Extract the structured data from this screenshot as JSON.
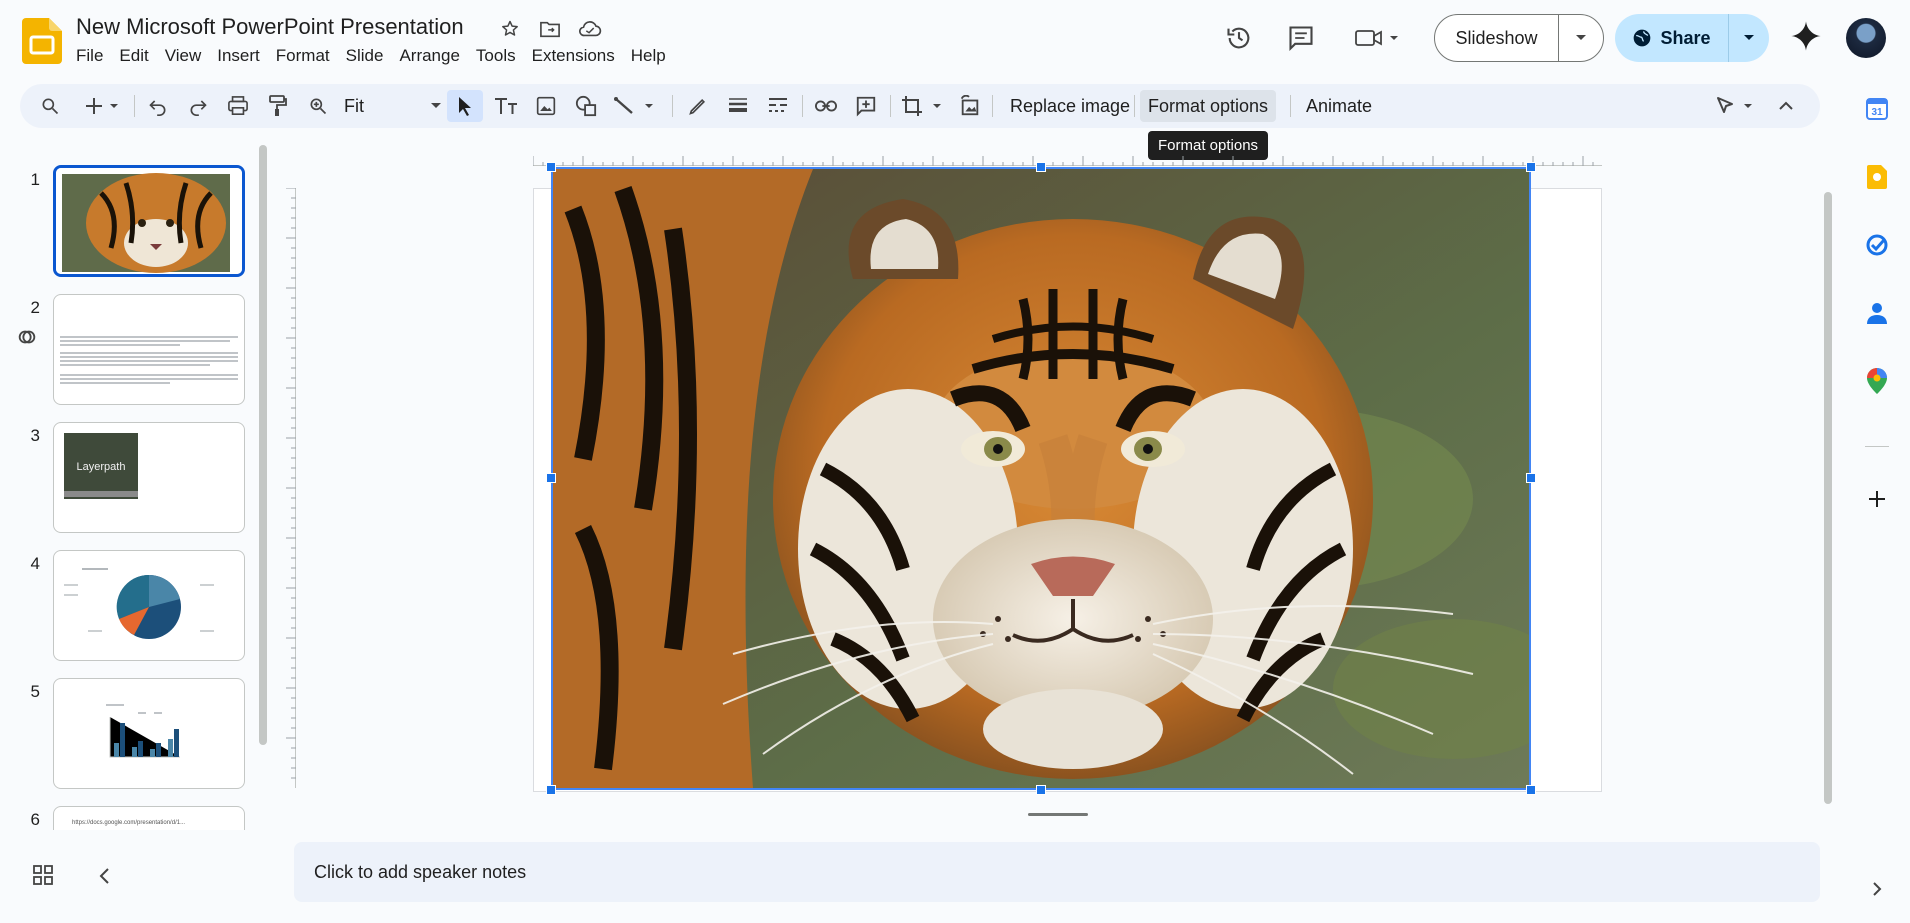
{
  "app": {
    "title": "New Microsoft PowerPoint Presentation"
  },
  "menu": [
    "File",
    "Edit",
    "View",
    "Insert",
    "Format",
    "Slide",
    "Arrange",
    "Tools",
    "Extensions",
    "Help"
  ],
  "header": {
    "slideshow_label": "Slideshow",
    "share_label": "Share"
  },
  "toolbar": {
    "zoom_value": "Fit",
    "replace_image_label": "Replace image",
    "format_options_label": "Format options",
    "animate_label": "Animate",
    "tooltip": "Format options"
  },
  "slides": [
    {
      "number": "1",
      "type": "image"
    },
    {
      "number": "2",
      "type": "text"
    },
    {
      "number": "3",
      "type": "image",
      "caption": "Layerpath"
    },
    {
      "number": "4",
      "type": "pie-chart"
    },
    {
      "number": "5",
      "type": "bar-chart"
    },
    {
      "number": "6",
      "type": "text",
      "snippet": "https://docs.google.com/presentation/d/1..."
    }
  ],
  "speaker_notes": {
    "placeholder": "Click to add speaker notes"
  },
  "colors": {
    "accent": "#0b57d0",
    "share_bg": "#c2e7ff",
    "toolbar_bg": "#edf2fa",
    "selection": "#1a73e8"
  },
  "icons": {
    "topbar": [
      "star-icon",
      "move-folder-icon",
      "cloud-status-icon",
      "history-icon",
      "comment-icon",
      "meet-icon",
      "gemini-icon"
    ],
    "side_panel": [
      "calendar-icon",
      "keep-icon",
      "tasks-icon",
      "contacts-icon",
      "maps-icon",
      "add-icon"
    ]
  }
}
